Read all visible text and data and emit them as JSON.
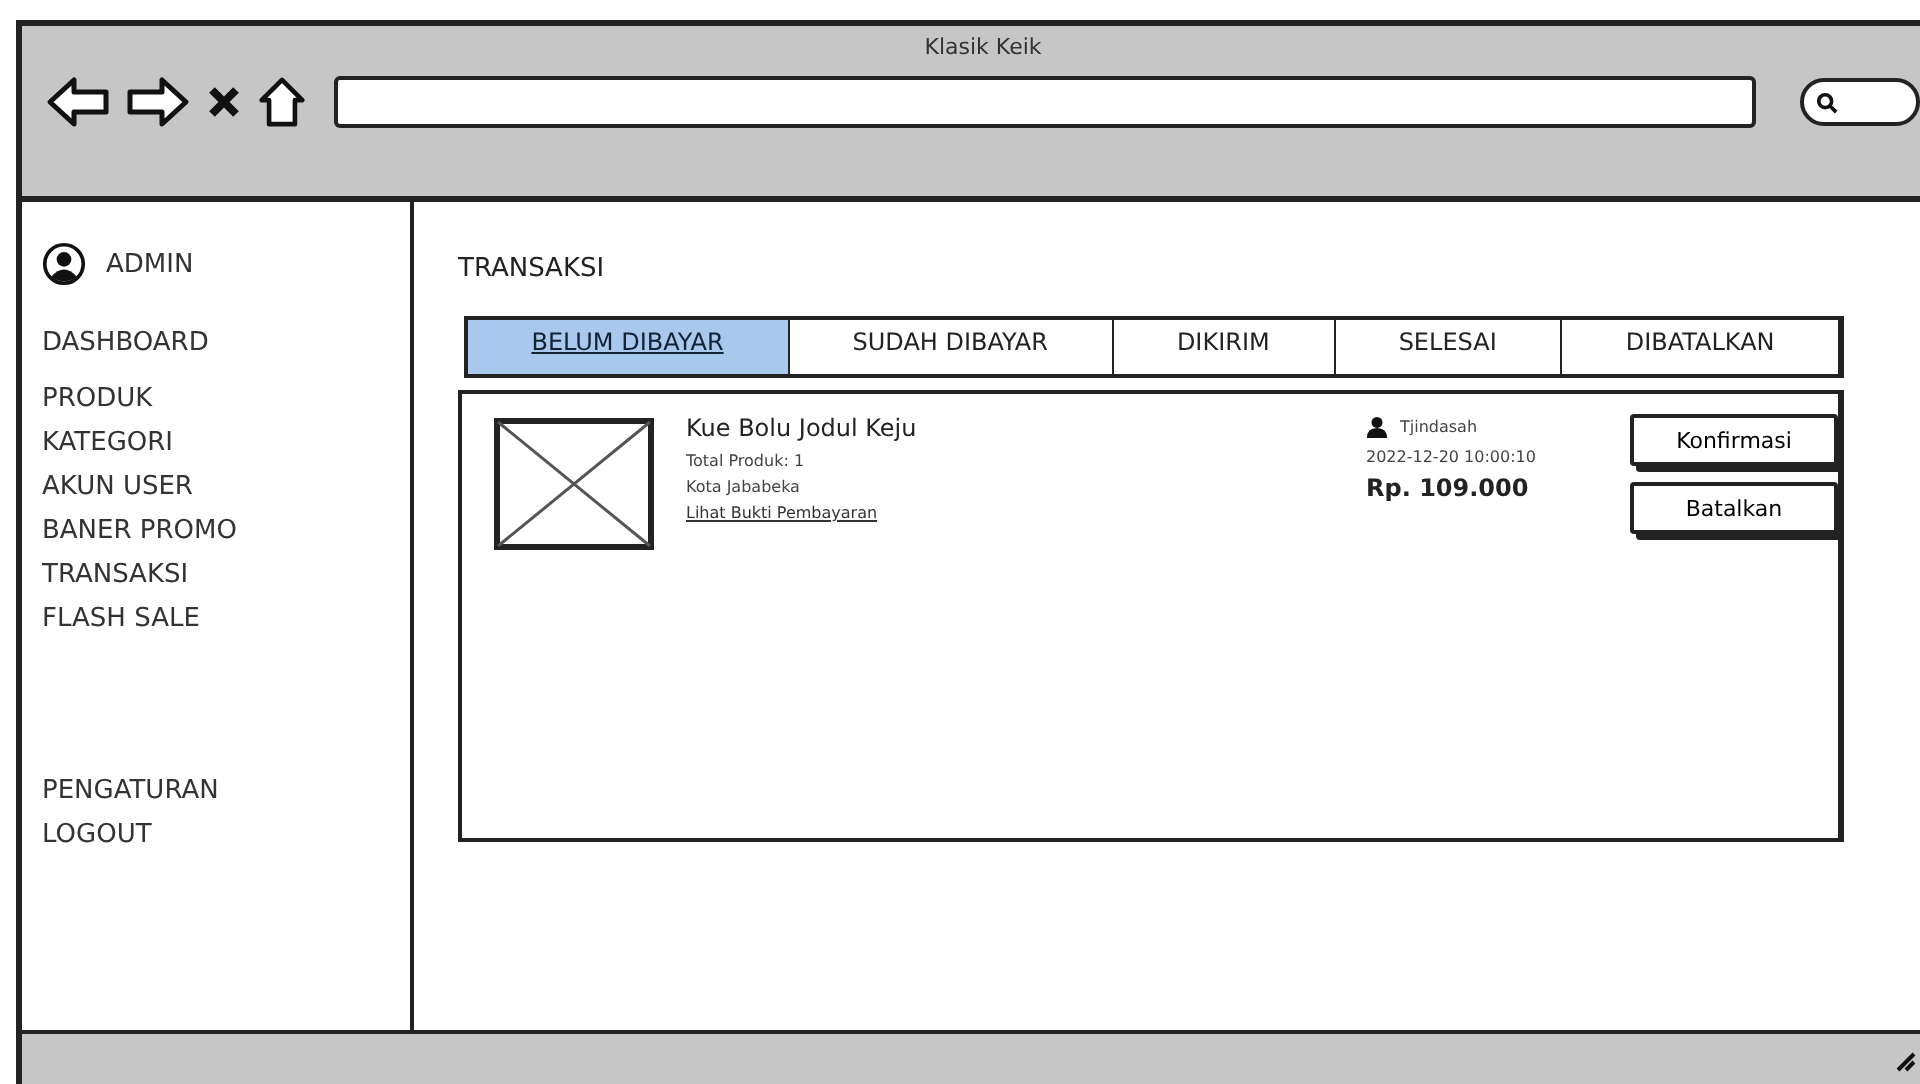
{
  "window": {
    "title": "Klasik Keik"
  },
  "sidebar": {
    "user": "ADMIN",
    "groups": [
      [
        "DASHBOARD"
      ],
      [
        "PRODUK",
        "KATEGORI",
        "AKUN USER",
        "BANER PROMO",
        "TRANSAKSI",
        "FLASH SALE"
      ],
      [
        "PENGATURAN",
        "LOGOUT"
      ]
    ]
  },
  "page_title": "TRANSAKSI",
  "tabs": [
    {
      "label": "BELUM DIBAYAR",
      "selected": true
    },
    {
      "label": "SUDAH DIBAYAR",
      "selected": false
    },
    {
      "label": "DIKIRIM",
      "selected": false
    },
    {
      "label": "SELESAI",
      "selected": false
    },
    {
      "label": "DIBATALKAN",
      "selected": false
    }
  ],
  "orders": [
    {
      "product": "Kue Bolu Jodul Keju",
      "total": "Total Produk: 1",
      "city": "Kota Jababeka",
      "proof_link": "Lihat Bukti Pembayaran",
      "customer": "Tjindasah",
      "datetime": "2022-12-20  10:00:10",
      "price": "Rp. 109.000",
      "buttons": [
        "Konfirmasi",
        "Batalkan"
      ]
    }
  ]
}
